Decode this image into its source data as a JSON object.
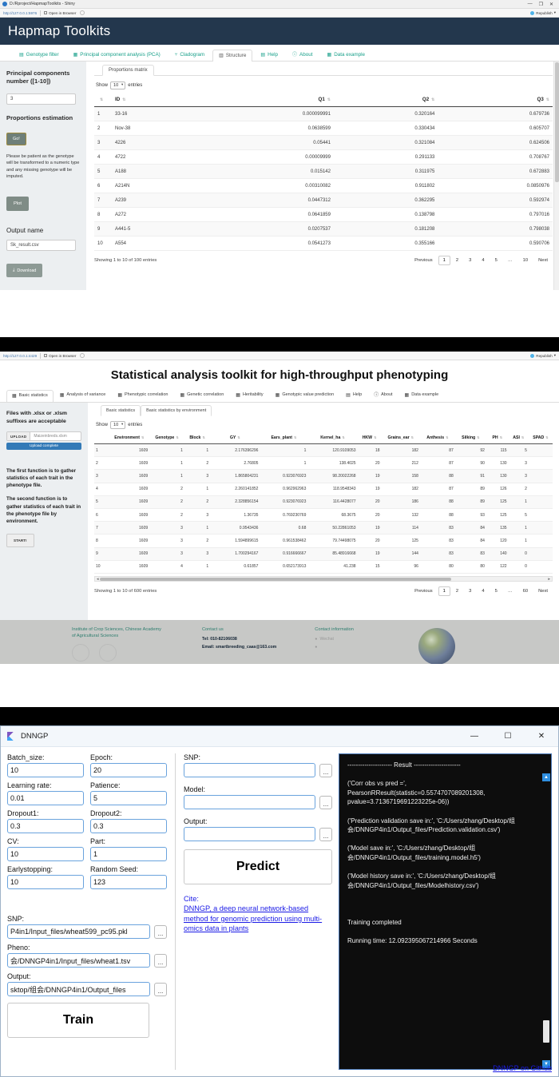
{
  "panel1": {
    "window": {
      "title": "D:/Rproject/HapmapToolkits - Shiny",
      "minimize": "—",
      "maximize": "❐",
      "close": "✕"
    },
    "urlbar": {
      "url": "http://127.0.0.1:5976",
      "open_in_browser": "Open in Browser",
      "republish": "Republish",
      "republish_caret": "▾"
    },
    "app_title": "Hapmap Toolkits",
    "tabs": [
      {
        "label": "Genotype filter",
        "icon": "list-icon",
        "active": false
      },
      {
        "label": "Principal component analysis (PCA)",
        "icon": "chart-icon",
        "active": false
      },
      {
        "label": "Cladogram",
        "icon": "tree-icon",
        "active": false
      },
      {
        "label": "Structure",
        "icon": "bars-icon",
        "active": true
      },
      {
        "label": "Help",
        "icon": "book-icon",
        "active": false
      },
      {
        "label": "About",
        "icon": "info-icon",
        "active": false
      },
      {
        "label": "Data example",
        "icon": "table-icon",
        "active": false
      }
    ],
    "sidebar": {
      "pc_label": "Principal components number ([1-10])",
      "pc_value": "3",
      "proportions_label": "Proportions estimation",
      "go_button": "Go!",
      "note": "Please be patient as the genotype will be transformed to a numeric type and any missing genotype will be imputed.",
      "plot_button": "Plot",
      "output_label": "Output name",
      "output_value": "Sk_result.csv",
      "download_button": "Download",
      "download_icon": "download-icon"
    },
    "subtab": "Proportions matrix",
    "show_label": "Show",
    "show_value": "10",
    "entries_label": "entries",
    "table": {
      "columns": [
        "",
        "ID",
        "Q1",
        "Q2",
        "Q3"
      ],
      "sort_icon": "sort-icon",
      "rows": [
        [
          "1",
          "33-16",
          "0.000099991",
          "0.320164",
          "0.679736"
        ],
        [
          "2",
          "Nov-38",
          "0.0638599",
          "0.330434",
          "0.605707"
        ],
        [
          "3",
          "4226",
          "0.05441",
          "0.321084",
          "0.624506"
        ],
        [
          "4",
          "4722",
          "0.00009999",
          "0.291133",
          "0.708767"
        ],
        [
          "5",
          "A188",
          "0.015142",
          "0.311975",
          "0.672883"
        ],
        [
          "6",
          "A214N",
          "0.00310082",
          "0.911802",
          "0.0850976"
        ],
        [
          "7",
          "A239",
          "0.0447312",
          "0.362295",
          "0.592974"
        ],
        [
          "8",
          "A272",
          "0.0641859",
          "0.138798",
          "0.797016"
        ],
        [
          "9",
          "A441-5",
          "0.0207537",
          "0.181208",
          "0.798038"
        ],
        [
          "10",
          "A554",
          "0.0541273",
          "0.355166",
          "0.590706"
        ]
      ]
    },
    "footer": {
      "info": "Showing 1 to 10 of 100 entries",
      "previous": "Previous",
      "pages": [
        "1",
        "2",
        "3",
        "4",
        "5",
        "…",
        "10"
      ],
      "current_page": "1",
      "next": "Next"
    }
  },
  "panel2": {
    "urlbar": {
      "url": "http://127.0.0.1:4429",
      "open_in_browser": "Open in Browser",
      "republish": "Republish",
      "republish_caret": "▾"
    },
    "app_title": "Statistical analysis toolkit for high-throughput phenotyping",
    "tabs": [
      {
        "label": "Basic statistics",
        "icon": "table-icon",
        "active": true
      },
      {
        "label": "Analysis of variance",
        "icon": "table-icon",
        "active": false
      },
      {
        "label": "Phenotypic correlation",
        "icon": "table-icon",
        "active": false
      },
      {
        "label": "Genetic correlation",
        "icon": "table-icon",
        "active": false
      },
      {
        "label": "Heritability",
        "icon": "table-icon",
        "active": false
      },
      {
        "label": "Genotypic value prediction",
        "icon": "table-icon",
        "active": false
      },
      {
        "label": "Help",
        "icon": "book-icon",
        "active": false
      },
      {
        "label": "About",
        "icon": "info-icon",
        "active": false
      },
      {
        "label": "Data example",
        "icon": "table-icon",
        "active": false
      }
    ],
    "sidebar": {
      "files_note": "Files with .xlsx or .xlsm suffixes are acceptable",
      "upload_button": "UPLOAD",
      "upload_filename": "Maizeinbreds.xlsm",
      "upload_progress": "Upload complete",
      "func1": "The first function is to gather statistics of each trait in the phenotype file.",
      "func2": "The second function is to gather statistics of each trait in the phenotype file by environment.",
      "start_button": "START!"
    },
    "subtabs": [
      "Basic statistics",
      "Basic statistics by environment"
    ],
    "active_subtab": "Basic statistics",
    "show_label": "Show",
    "show_value": "10",
    "entries_label": "entries",
    "table": {
      "columns": [
        "",
        "Environment",
        "Genotype",
        "Block",
        "GY",
        "Ears_plant",
        "Kernel_ha",
        "HKW",
        "Grains_ear",
        "Anthesis",
        "Silking",
        "PH",
        "ASI",
        "SPAD"
      ],
      "rows": [
        [
          "1",
          "1609",
          "1",
          "1",
          "2.176396296",
          "1",
          "120.9109053",
          "18",
          "182",
          "87",
          "92",
          "115",
          "5",
          ""
        ],
        [
          "2",
          "1609",
          "1",
          "2",
          "2.76805",
          "1",
          "138.4025",
          "20",
          "212",
          "87",
          "90",
          "130",
          "3",
          ""
        ],
        [
          "3",
          "1609",
          "1",
          "3",
          "1.865804231",
          "0.923076923",
          "98.20022268",
          "19",
          "158",
          "88",
          "91",
          "130",
          "3",
          ""
        ],
        [
          "4",
          "1609",
          "2",
          "1",
          "2.260141852",
          "0.962962963",
          "118.9548343",
          "19",
          "182",
          "87",
          "89",
          "126",
          "2",
          ""
        ],
        [
          "5",
          "1609",
          "2",
          "2",
          "2.328856154",
          "0.923076923",
          "116.4428077",
          "20",
          "186",
          "88",
          "89",
          "125",
          "1",
          ""
        ],
        [
          "6",
          "1609",
          "2",
          "3",
          "1.36735",
          "0.769230769",
          "68.3675",
          "20",
          "132",
          "88",
          "93",
          "125",
          "5",
          ""
        ],
        [
          "7",
          "1609",
          "3",
          "1",
          "0.9543436",
          "0.68",
          "50.22861053",
          "19",
          "114",
          "83",
          "84",
          "135",
          "1",
          ""
        ],
        [
          "8",
          "1609",
          "3",
          "2",
          "1.594899615",
          "0.961538462",
          "79.74498075",
          "20",
          "125",
          "83",
          "84",
          "120",
          "1",
          ""
        ],
        [
          "9",
          "1609",
          "3",
          "3",
          "1.700294167",
          "0.916666667",
          "85.48916668",
          "19",
          "144",
          "83",
          "83",
          "140",
          "0",
          ""
        ],
        [
          "10",
          "1609",
          "4",
          "1",
          "0.61857",
          "0.652173913",
          "41.238",
          "15",
          "96",
          "80",
          "80",
          "122",
          "0",
          ""
        ]
      ]
    },
    "footer": {
      "info": "Showing 1 to 10 of 600 entries",
      "previous": "Previous",
      "pages": [
        "1",
        "2",
        "3",
        "4",
        "5",
        "…",
        "60"
      ],
      "current_page": "1",
      "next": "Next"
    },
    "page_footer": {
      "institute": "Institute of Crop Sciences, Chinese Academy of Agricultural Sciences",
      "contact_us_title": "Contact us",
      "tel": "Tel: 010-82106038",
      "email": "Email: smartbreeding_caas@163.com",
      "contact_info_title": "Contact information",
      "wechat": "Wechat",
      "wechat_icon": "wechat-icon",
      "globe_icon": "globe-icon",
      "seal_icon": "seal-icon"
    }
  },
  "panel3": {
    "window": {
      "title": "DNNGP",
      "app_icon": "dnngp-app-icon",
      "minimize": "—",
      "maximize": "☐",
      "close": "✕"
    },
    "params": [
      {
        "label": "Batch_size:",
        "value": "10"
      },
      {
        "label": "Learning rate:",
        "value": "0.01"
      },
      {
        "label": "Dropout1:",
        "value": "0.3"
      },
      {
        "label": "CV:",
        "value": "10"
      },
      {
        "label": "Earlystopping:",
        "value": "10"
      }
    ],
    "params2": [
      {
        "label": "Epoch:",
        "value": "20"
      },
      {
        "label": "Patience:",
        "value": "5"
      },
      {
        "label": "Dropout2:",
        "value": "0.3"
      },
      {
        "label": "Part:",
        "value": "1"
      },
      {
        "label": "Random Seed:",
        "value": "123"
      }
    ],
    "train_files": [
      {
        "label": "SNP:",
        "value": "P4in1/Input_files/wheat599_pc95.pkl",
        "browse": "..."
      },
      {
        "label": "Pheno:",
        "value": "会/DNNGP4in1/Input_files/wheat1.tsv",
        "browse": "..."
      },
      {
        "label": "Output:",
        "value": "sktop/组会/DNNGP4in1/Output_files",
        "browse": "..."
      }
    ],
    "train_button": "Train",
    "predict_files": [
      {
        "label": "SNP:",
        "value": "",
        "browse": "..."
      },
      {
        "label": "Model:",
        "value": "",
        "browse": "..."
      },
      {
        "label": "Output:",
        "value": "",
        "browse": "..."
      }
    ],
    "predict_button": "Predict",
    "cite_label": "Cite:",
    "cite_link": "DNNGP, a deep neural network-based method for genomic prediction using multi-omics data in plants",
    "console_text": "--------------------- Result ----------------------\n\n('Corr obs vs pred =',\nPearsonRResult(statistic=0.5574707089201308,\npvalue=3.7136719691223225e-06))\n\n('Prediction validation save in:', 'C:/Users/zhang/Desktop/组会/DNNGP4in1/Output_files/Prediction.validation.csv')\n\n('Model save in:', 'C:/Users/zhang/Desktop/组会/DNNGP4in1/Output_files/training.model.h5')\n\n('Model history save in:', 'C:/Users/zhang/Desktop/组会/DNNGP4in1/Output_files/Modelhistory.csv')\n\n\n\nTraining completed\n\nRunning time: 12.092395067214966 Seconds",
    "github_link": "DNNGP on Github",
    "scroll_up": "▲",
    "scroll_down": "▼"
  },
  "colors": {
    "panel1_header": "#23374d",
    "panel1_accent": "#18a08a",
    "panel2_footer": "#c7c8c6",
    "panel2_link": "#2d7d6e",
    "upload_blue": "#337ab7",
    "dnngp_border": "#4a78b8",
    "link_blue": "#1a1ae6"
  }
}
